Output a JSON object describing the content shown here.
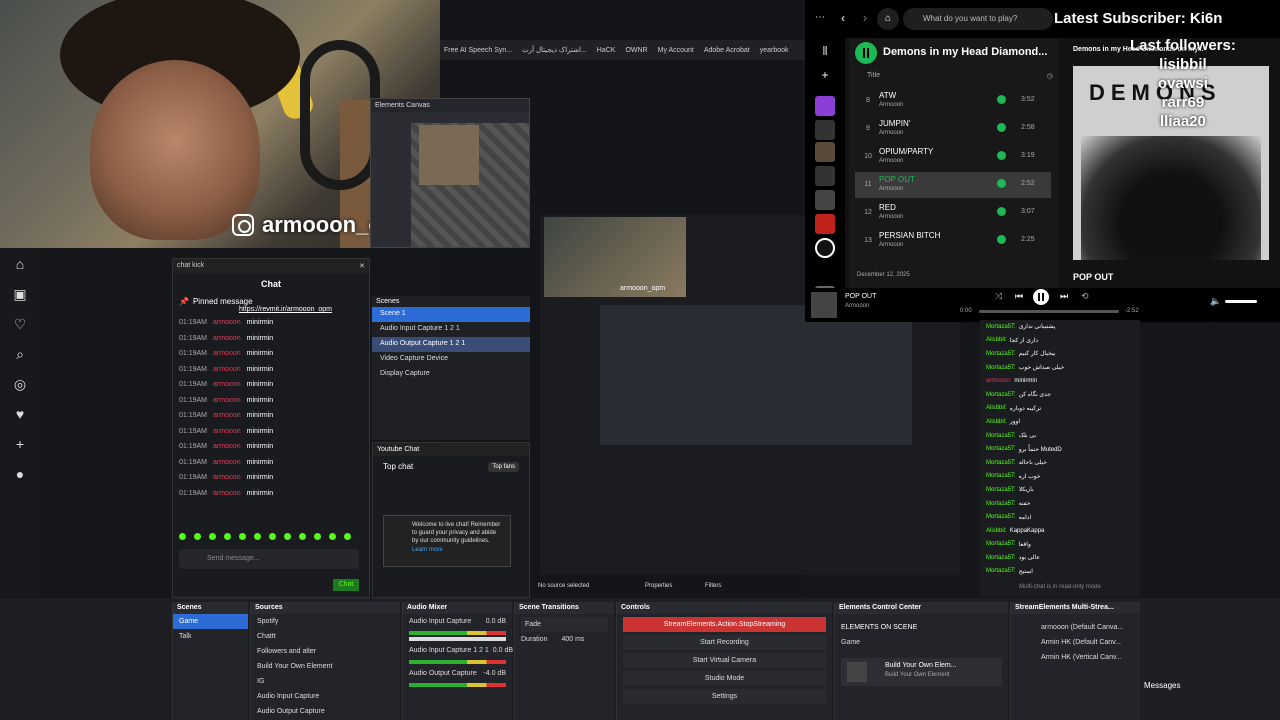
{
  "overlay": {
    "instagram_handle": "armooon_opm",
    "latest_subscriber": "Latest Subscriber: Ki6n",
    "last_followers_title": "Last followers:",
    "followers": [
      "lisibbil",
      "ovawsi",
      "rarr69",
      "lliaa20"
    ]
  },
  "browser_tabs": [
    "Free AI Speech Syn...",
    "اشتراک دیجیتال آرت...",
    "HaCK",
    "OWNR",
    "My Account",
    "Adobe Acrobat",
    "yearbook"
  ],
  "elements_canvas": {
    "title": "Elements Canvas"
  },
  "chat_kick": {
    "header": "chat kick",
    "title": "Chat",
    "pinned_label": "Pinned message",
    "pinned_link": "https://revmit.ir/armooon_opm",
    "rows": [
      {
        "time": "01:19AM",
        "user": "armooon",
        "msg": "minirmin"
      },
      {
        "time": "01:19AM",
        "user": "armooon",
        "msg": "minirmin"
      },
      {
        "time": "01:19AM",
        "user": "armooon",
        "msg": "minirmin"
      },
      {
        "time": "01:19AM",
        "user": "armooon",
        "msg": "minirmin"
      },
      {
        "time": "01:19AM",
        "user": "armooon",
        "msg": "minirmin"
      },
      {
        "time": "01:19AM",
        "user": "armooon",
        "msg": "minirmin"
      },
      {
        "time": "01:19AM",
        "user": "armooon",
        "msg": "minirmin"
      },
      {
        "time": "01:19AM",
        "user": "armooon",
        "msg": "minirmin"
      },
      {
        "time": "01:19AM",
        "user": "armooon",
        "msg": "minirmin"
      },
      {
        "time": "01:19AM",
        "user": "armooon",
        "msg": "minirmin"
      },
      {
        "time": "01:19AM",
        "user": "armooon",
        "msg": "minirmin"
      },
      {
        "time": "01:19AM",
        "user": "armooon",
        "msg": "minirmin"
      }
    ],
    "send_placeholder": "Send message...",
    "chat_button": "Chat"
  },
  "scenes_mini": {
    "title": "Scenes",
    "items": [
      "Scene 1",
      "Audio Input Capture 1 2 1",
      "Audio Output Capture 1 2 1",
      "Video Capture Device",
      "Display Capture"
    ]
  },
  "youtube_chat": {
    "title": "Youtube Chat",
    "top_chat": "Top chat",
    "top_fans": "Top fans",
    "welcome": "Welcome to live chat! Remember to guard your privacy and abide by our community guidelines.",
    "learn_more": "Learn more"
  },
  "preview": {
    "handle": "armooon_opm"
  },
  "spotify": {
    "search_placeholder": "What do you want to play?",
    "playlist_title": "Demons in my Head Diamond...",
    "header_title": "Title",
    "tracks": [
      {
        "n": "8",
        "title": "ATW",
        "artist": "Armooon",
        "dur": "3:52"
      },
      {
        "n": "9",
        "title": "JUMPIN'",
        "artist": "Armooon",
        "dur": "2:58"
      },
      {
        "n": "10",
        "title": "OPIUM/PARTY",
        "artist": "Armooon",
        "dur": "3:19"
      },
      {
        "n": "11",
        "title": "POP OUT",
        "artist": "Armooon",
        "dur": "2:52"
      },
      {
        "n": "12",
        "title": "RED",
        "artist": "Armooon",
        "dur": "3:07"
      },
      {
        "n": "13",
        "title": "PERSIAN BITCH",
        "artist": "Armooon",
        "dur": "2:25"
      }
    ],
    "current_index": 3,
    "date": "December 12, 2025",
    "album_label": "Demons in my Head Diamonds on my...",
    "cover_text": "DEMONS",
    "pop_out": "POP OUT",
    "now_playing": "POP OUT",
    "now_artist": "Armooon",
    "time_elapsed": "0:00",
    "time_total": "-2:52",
    "progress": 0.0
  },
  "multi_chat": {
    "rows": [
      {
        "user": "Mortaza5T:",
        "msg": "پشتیبانی نداری",
        "k": false
      },
      {
        "user": "Alisbbil:",
        "msg": "داری از کجا",
        "k": false
      },
      {
        "user": "Mortaza5T:",
        "msg": "بیخیال کار کنیم",
        "k": false
      },
      {
        "user": "Mortaza5T:",
        "msg": "خیلی صداش خوب",
        "k": false
      },
      {
        "user": "armooon:",
        "msg": "minirmin",
        "k": true
      },
      {
        "user": "Mortaza5T:",
        "msg": "جدی نگاه کن",
        "k": false
      },
      {
        "user": "Alisbbil:",
        "msg": "ترکیبه دوباره",
        "k": false
      },
      {
        "user": "Alisbbil:",
        "msg": "اوور",
        "k": false
      },
      {
        "user": "Mortaza5T:",
        "msg": "بی بلک",
        "k": false
      },
      {
        "user": "Mortaza5T:",
        "msg": "حتماً برو MutedD",
        "k": false
      },
      {
        "user": "Mortaza5T:",
        "msg": "خیلی باحاله",
        "k": false
      },
      {
        "user": "Mortaza5T:",
        "msg": "خوب اره",
        "k": false
      },
      {
        "user": "Mortaza5T:",
        "msg": "باریکلا",
        "k": false
      },
      {
        "user": "Mortaza5T:",
        "msg": "خفنه",
        "k": false
      },
      {
        "user": "Mortaza5T:",
        "msg": "ادامه",
        "k": false
      },
      {
        "user": "Alisbbil:",
        "msg": "KappaKappa",
        "k": false
      },
      {
        "user": "Mortaza5T:",
        "msg": "واقعا",
        "k": false
      },
      {
        "user": "Mortaza5T:",
        "msg": "عالی بود",
        "k": false
      },
      {
        "user": "Mortaza5T:",
        "msg": "استیج",
        "k": false
      }
    ],
    "read_only": "Multi-chat is in read-only mode"
  },
  "obs_status": {
    "no_source": "No source selected",
    "properties": "Properties",
    "filters": "Filters"
  },
  "obs": {
    "scenes": {
      "title": "Scenes",
      "items": [
        "Game",
        "Talk"
      ]
    },
    "sources": {
      "title": "Sources",
      "items": [
        "Spotify",
        "Chattt",
        "Followers and alter",
        "Build Your Own Element",
        "IG",
        "Audio Input Capture",
        "Audio Output Capture"
      ]
    },
    "mixer": {
      "title": "Audio Mixer",
      "ch1": "Audio Input Capture",
      "ch1_db": "0.0 dB",
      "ch2": "Audio Input Capture 1 2 1",
      "ch2_db": "0.0 dB",
      "ch3": "Audio Output Capture",
      "ch3_db": "-4.0 dB"
    },
    "transitions": {
      "title": "Scene Transitions",
      "type": "Fade",
      "duration_label": "Duration",
      "duration": "400 ms"
    },
    "controls": {
      "title": "Controls",
      "stop": "StreamElements.Action.StopStreaming",
      "record": "Start Recording",
      "virtual": "Start Virtual Camera",
      "studio": "Studio Mode",
      "settings": "Settings"
    },
    "elements": {
      "title": "Elements Control Center",
      "on_scene": "ELEMENTS ON SCENE",
      "scene": "Game",
      "item": "Build Your Own Elem...",
      "item_sub": "Build Your Own Element"
    },
    "multistream": {
      "title": "StreamElements Multi-Strea...",
      "rows": [
        "armooon (Default Canva...",
        "Armin HK (Default Canv...",
        "Armin HK (Vertical Canv..."
      ]
    }
  },
  "messages_label": "Messages"
}
